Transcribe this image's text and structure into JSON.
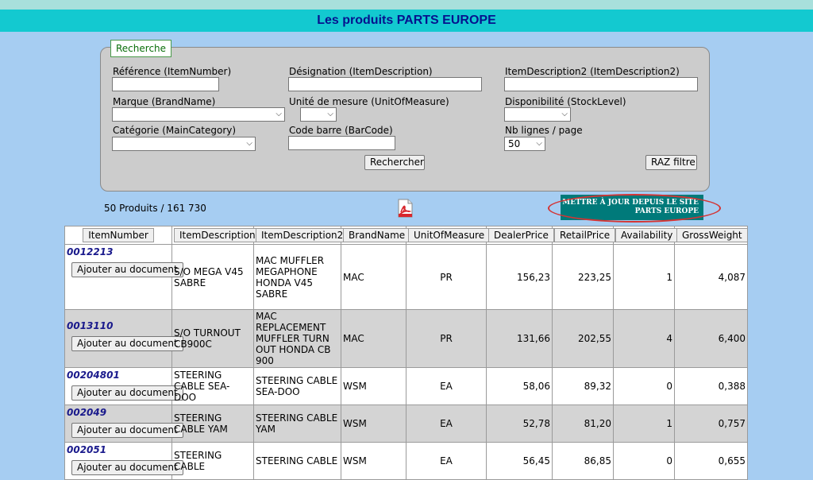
{
  "page_title": "Les produits PARTS EUROPE",
  "search": {
    "legend": "Recherche",
    "ref_label": "Référence (ItemNumber)",
    "desig_label": "Désignation (ItemDescription)",
    "desc2_label": "ItemDescription2 (ItemDescription2)",
    "brand_label": "Marque (BrandName)",
    "uom_label": "Unité de mesure (UnitOfMeasure)",
    "stock_label": "Disponibilité (StockLevel)",
    "cat_label": "Catégorie (MainCategory)",
    "barcode_label": "Code barre (BarCode)",
    "lines_label": "Nb lignes / page",
    "lines_value": "50",
    "search_button": "Rechercher",
    "reset_button": "RAZ filtre"
  },
  "count": "50 Produits / 161 730",
  "update_button": {
    "line1": "METTRE À JOUR DEPUIS LE SITE",
    "line2": "PARTS EUROPE"
  },
  "table": {
    "columns": [
      "ItemNumber",
      "ItemDescription",
      "ItemDescription2",
      "BrandName",
      "UnitOfMeasure",
      "DealerPrice",
      "RetailPrice",
      "Availability",
      "GrossWeight"
    ],
    "add_label": "Ajouter au document",
    "rows": [
      {
        "item": "0012213",
        "desc": "S/O MEGA V45 SABRE",
        "desc2": "MAC MUFFLER MEGAPHONE HONDA V45 SABRE",
        "brand": "MAC",
        "uom": "PR",
        "dealer": "156,23",
        "retail": "223,25",
        "avail": "1",
        "weight": "4,087"
      },
      {
        "item": "0013110",
        "desc": "S/O TURNOUT CB900C",
        "desc2": "MAC REPLACEMENT MUFFLER TURN OUT HONDA CB 900",
        "brand": "MAC",
        "uom": "PR",
        "dealer": "131,66",
        "retail": "202,55",
        "avail": "4",
        "weight": "6,400"
      },
      {
        "item": "00204801",
        "desc": "STEERING CABLE SEA-DOO",
        "desc2": "STEERING CABLE SEA-DOO",
        "brand": "WSM",
        "uom": "EA",
        "dealer": "58,06",
        "retail": "89,32",
        "avail": "0",
        "weight": "0,388"
      },
      {
        "item": "002049",
        "desc": "STEERING CABLE YAM",
        "desc2": "STEERING CABLE YAM",
        "brand": "WSM",
        "uom": "EA",
        "dealer": "52,78",
        "retail": "81,20",
        "avail": "1",
        "weight": "0,757"
      },
      {
        "item": "002051",
        "desc": "STEERING CABLE",
        "desc2": "STEERING CABLE",
        "brand": "WSM",
        "uom": "EA",
        "dealer": "56,45",
        "retail": "86,85",
        "avail": "0",
        "weight": "0,655"
      }
    ]
  }
}
